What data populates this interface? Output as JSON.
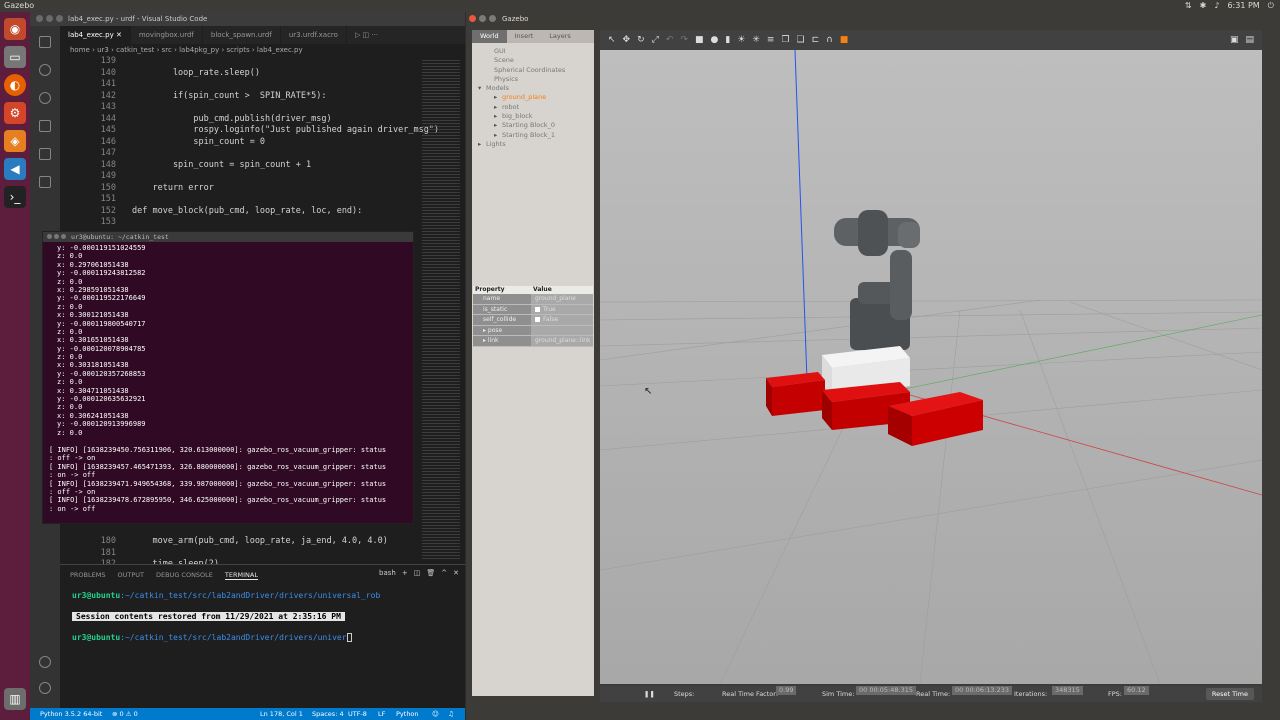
{
  "topbar": {
    "app_name": "Gazebo",
    "time": "6:31 PM"
  },
  "vscode": {
    "title": "lab4_exec.py - urdf - Visual Studio Code",
    "tabs": [
      {
        "label": "lab4_exec.py",
        "active": true
      },
      {
        "label": "movingbox.urdf",
        "active": false
      },
      {
        "label": "block_spawn.urdf",
        "active": false
      },
      {
        "label": "ur3.urdf.xacro",
        "active": false
      }
    ],
    "breadcrumb": "home  ›  ur3  ›  catkin_test  ›  src  ›  lab4pkg_py  ›  scripts  ›  lab4_exec.py",
    "code_lines": [
      {
        "num": "139",
        "text": ""
      },
      {
        "num": "140",
        "text": "        loop_rate.sleep()"
      },
      {
        "num": "141",
        "text": ""
      },
      {
        "num": "142",
        "text": "        if(spin_count >  SPIN_RATE*5):"
      },
      {
        "num": "143",
        "text": ""
      },
      {
        "num": "144",
        "text": "            pub_cmd.publish(driver_msg)"
      },
      {
        "num": "145",
        "text": "            rospy.loginfo(\"Just published again driver_msg\")"
      },
      {
        "num": "146",
        "text": "            spin_count = 0"
      },
      {
        "num": "147",
        "text": ""
      },
      {
        "num": "148",
        "text": "        spin_count = spin_count + 1"
      },
      {
        "num": "149",
        "text": ""
      },
      {
        "num": "150",
        "text": "    return error"
      },
      {
        "num": "151",
        "text": ""
      },
      {
        "num": "152",
        "text": "def move_block(pub_cmd, loop_rate, loc, end):"
      },
      {
        "num": "153",
        "text": ""
      }
    ],
    "code_lines_lower": [
      {
        "num": "180",
        "text": "    move_arm(pub_cmd, loop_rate, ja_end, 4.0, 4.0)"
      },
      {
        "num": "181",
        "text": ""
      },
      {
        "num": "182",
        "text": "    time.sleep(2)"
      }
    ],
    "panel": {
      "tabs": [
        "PROBLEMS",
        "OUTPUT",
        "DEBUG CONSOLE",
        "TERMINAL"
      ],
      "active_tab": "TERMINAL",
      "shell": "bash",
      "prompt_user": "ur3@ubuntu",
      "prompt_path_1": ":~/catkin_test/src/lab2andDriver/drivers/universal_rob",
      "restored_message": "Session contents restored from 11/29/2021 at 2:35:16 PM",
      "prompt_path_2": ":~/catkin_test/src/lab2andDriver/drivers/univer"
    },
    "status": {
      "python": "Python 3.5.2 64-bit",
      "problems": "⊗ 0  ⚠ 0",
      "position": "Ln 178, Col 1",
      "spaces": "Spaces: 4",
      "encoding": "UTF-8",
      "eol": "LF",
      "language": "Python"
    }
  },
  "terminal": {
    "title": "ur3@ubuntu: ~/catkin_test",
    "lines": [
      "y: -0.000119151024559",
      "z: 0.0",
      "x: 0.297061051438",
      "y: -0.000119243812582",
      "z: 0.0",
      "x: 0.298591051438",
      "y: -0.000119522176649",
      "z: 0.0",
      "x: 0.300121051438",
      "y: -0.000119800540717",
      "z: 0.0",
      "x: 0.301651051438",
      "y: -0.000120078904785",
      "z: 0.0",
      "x: 0.303181051438",
      "y: -0.000120357268853",
      "z: 0.0",
      "x: 0.304711051438",
      "y: -0.000120635632921",
      "z: 0.0",
      "x: 0.306241051438",
      "y: -0.000120913996989",
      "z: 0.0"
    ],
    "info_lines": [
      "[ INFO] [1638239450.756311906, 320.613000000]: gazebo_ros_vacuum_gripper: status",
      ": off -> on",
      "[ INFO] [1638239457.465471393, 326.880000000]: gazebo_ros_vacuum_gripper: status",
      ": on -> off",
      "[ INFO] [1638239471.949654368, 339.987000000]: gazebo_ros_vacuum_gripper: status",
      ": off -> on",
      "[ INFO] [1638239478.672895950, 346.625000000]: gazebo_ros_vacuum_gripper: status",
      ": on -> off"
    ]
  },
  "gazebo": {
    "title": "Gazebo",
    "left_tabs": [
      "World",
      "Insert",
      "Layers"
    ],
    "active_left_tab": "World",
    "tree": [
      {
        "label": "GUI",
        "indent": 1,
        "selected": false,
        "arrow": ""
      },
      {
        "label": "Scene",
        "indent": 1,
        "selected": false,
        "arrow": ""
      },
      {
        "label": "Spherical Coordinates",
        "indent": 1,
        "selected": false,
        "arrow": ""
      },
      {
        "label": "Physics",
        "indent": 1,
        "selected": false,
        "arrow": ""
      },
      {
        "label": "Models",
        "indent": 0,
        "selected": false,
        "arrow": "▾"
      },
      {
        "label": "ground_plane",
        "indent": 2,
        "selected": true,
        "arrow": "▸"
      },
      {
        "label": "robot",
        "indent": 2,
        "selected": false,
        "arrow": "▸"
      },
      {
        "label": "big_block",
        "indent": 2,
        "selected": false,
        "arrow": "▸"
      },
      {
        "label": "Starting Block_0",
        "indent": 2,
        "selected": false,
        "arrow": "▸"
      },
      {
        "label": "Starting Block_1",
        "indent": 2,
        "selected": false,
        "arrow": "▸"
      },
      {
        "label": "Lights",
        "indent": 0,
        "selected": false,
        "arrow": "▸"
      }
    ],
    "properties": {
      "header_property": "Property",
      "header_value": "Value",
      "rows": [
        {
          "key": "name",
          "value": "ground_plane",
          "checkbox": false
        },
        {
          "key": "is_static",
          "value": "True",
          "checkbox": true
        },
        {
          "key": "self_collide",
          "value": "False",
          "checkbox": true
        },
        {
          "key": "▸ pose",
          "value": "",
          "checkbox": false
        },
        {
          "key": "▸ link",
          "value": "ground_plane::link",
          "checkbox": false
        }
      ]
    },
    "bottom": {
      "steps_label": "Steps:",
      "rtf_label": "Real Time Factor:",
      "rtf_value": "0.99",
      "sim_label": "Sim Time:",
      "sim_value": "00 00:05:48.315",
      "real_label": "Real Time:",
      "real_value": "00 00:06:13.233",
      "iter_label": "Iterations:",
      "iter_value": "348315",
      "fps_label": "FPS:",
      "fps_value": "60.12",
      "reset_label": "Reset Time"
    }
  }
}
